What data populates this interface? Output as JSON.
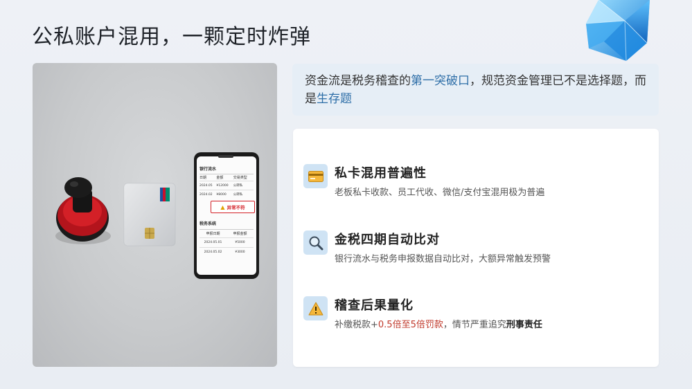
{
  "title": "公私账户混用，一颗定时炸弹",
  "callout": {
    "part1": "资金流是税务稽查的",
    "hl1": "第一突破口",
    "part2": "，规范资金管理已不是选择题，而是",
    "hl2": "生存题"
  },
  "items": [
    {
      "icon": "credit-card-icon",
      "heading": "私卡混用普遍性",
      "desc": "老板私卡收款、员工代收、微信/支付宝混用极为普遍"
    },
    {
      "icon": "search-icon",
      "heading": "金税四期自动比对",
      "desc": "银行流水与税务申报数据自动比对，大额异常触发预警"
    },
    {
      "icon": "warning-icon",
      "heading": "稽查后果量化",
      "desc_part1": "补缴税款+",
      "desc_red": "0.5倍至5倍罚款",
      "desc_part2": "，情节严重追究",
      "desc_bold": "刑事责任"
    }
  ],
  "phone": {
    "section1_title": "银行流水",
    "section1_headers": [
      "日期",
      "金额",
      "交易类型"
    ],
    "section1_rows": [
      [
        "2024.05",
        "¥12000",
        "公转私"
      ],
      [
        "2024.02",
        "¥8000",
        "公转私"
      ]
    ],
    "alert": "异常不符",
    "section2_title": "税务系统",
    "section2_headers": [
      "申报日期",
      "申报金额"
    ],
    "section2_rows": [
      [
        "2024.05.01",
        "¥5000"
      ],
      [
        "2024.05.02",
        "¥3000"
      ]
    ]
  },
  "colors": {
    "highlight": "#2f6fa8",
    "red": "#c0392b",
    "icon_bg": "#cfe3f4"
  }
}
